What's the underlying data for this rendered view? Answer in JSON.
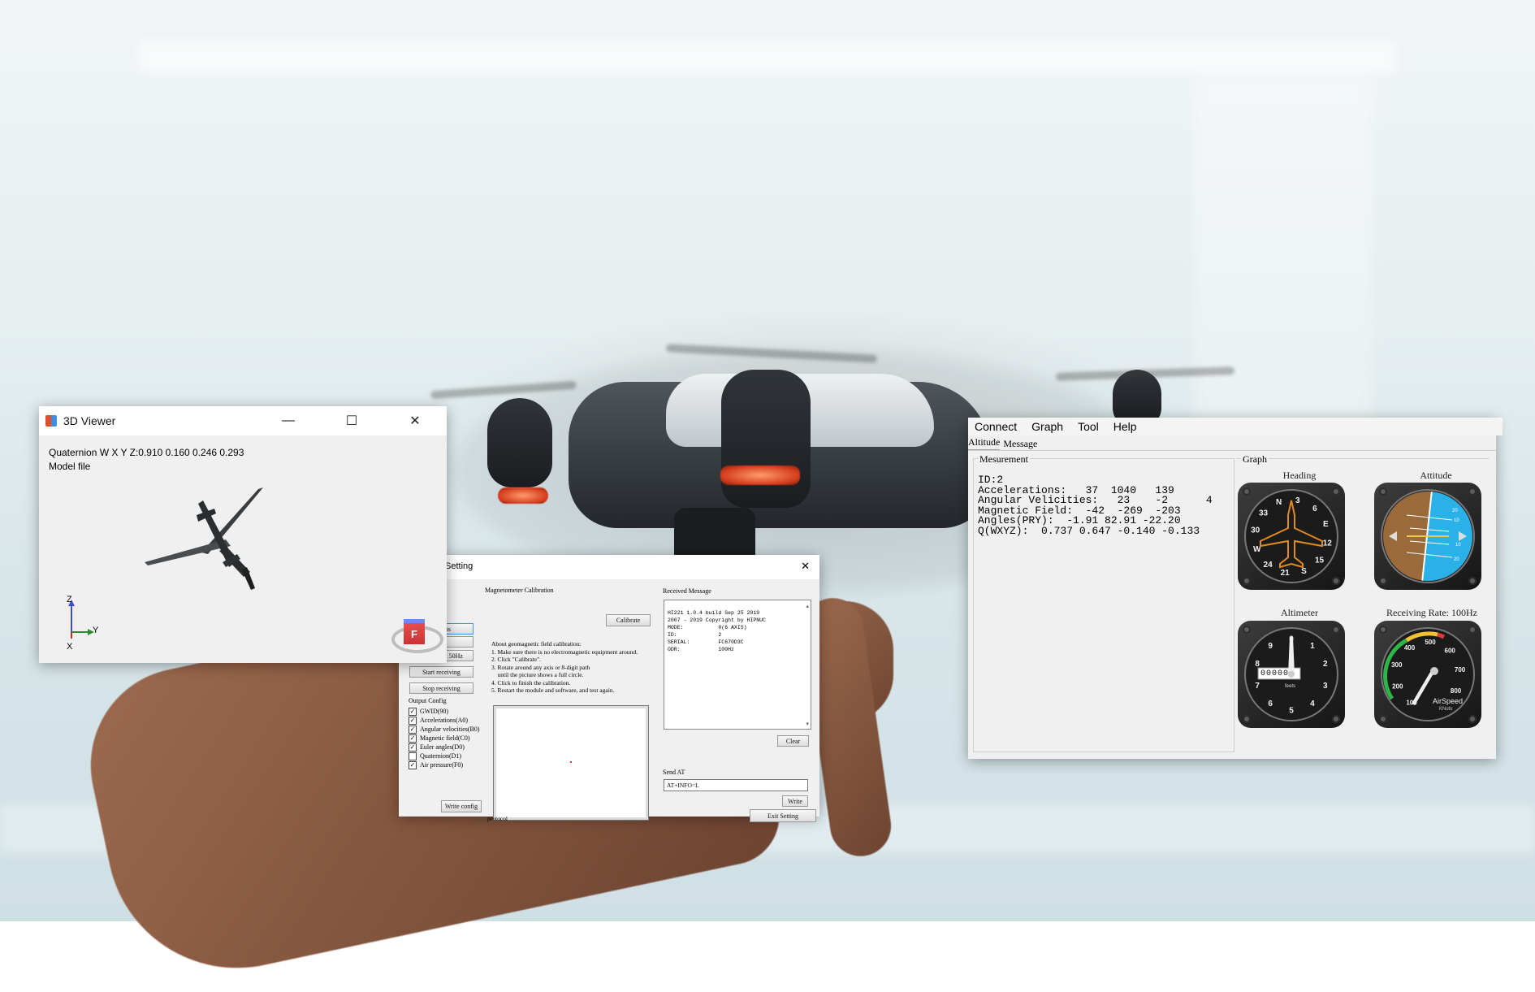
{
  "viewer": {
    "title": "3D Viewer",
    "quaternion_label": "Quaternion W X Y Z:0.910  0.160  0.246  0.293",
    "model_file_label": "Model file",
    "axis_z": "Z",
    "axis_y": "Y",
    "axis_x": "X",
    "cube_label": "F"
  },
  "settings": {
    "title_partial": "Setting",
    "left_buttons": [
      "nations",
      "Receive at 50Hz",
      "Start receiving",
      "Stop receiving"
    ],
    "output_config_label": "Output Config",
    "output_items": [
      {
        "label": "GWID(90)",
        "checked": true
      },
      {
        "label": "Accelerations(A0)",
        "checked": true
      },
      {
        "label": "Angular velocities(B0)",
        "checked": true
      },
      {
        "label": "Magnetic field(C0)",
        "checked": true
      },
      {
        "label": "Euler angles(D0)",
        "checked": true
      },
      {
        "label": "Quaternion(D1)",
        "checked": false
      },
      {
        "label": "Air pressure(F0)",
        "checked": true
      }
    ],
    "write_config_button": "Write config",
    "mag_cal_label": "Magnetometer Calibration",
    "calibrate_button": "Calibrate",
    "mag_instructions": [
      "About geomagnetic field calibration:",
      "1. Make sure there is no electromagnetic equipment around.",
      "2. Click \"Calibrate\".",
      "3. Rotate around any axis or 8-digit path",
      "    until the picture shows a full circle.",
      "4. Click to finish the calibration.",
      "5. Restart the module and software, and test again."
    ],
    "protocol_label": "protocol",
    "received_label": "Received Message",
    "received_lines": [
      "HI221 1.0.4 build Sep 25 2019",
      "2007 - 2019 Copyright by HIPNUC",
      "MODE:           0(6 AXIS)",
      "ID:             2",
      "SERIAL:         FC670D3C",
      "ODR:            100Hz"
    ],
    "clear_button": "Clear",
    "send_at_label": "Send AT",
    "send_at_value": "AT+INFO=L",
    "write_button": "Write",
    "exit_button": "Exit Setting"
  },
  "main_app": {
    "menu": [
      "Connect",
      "Graph",
      "Tool",
      "Help"
    ],
    "tabs": [
      "Altitude",
      "Message"
    ],
    "measurement_label": "Mesurement",
    "measurement_lines": [
      "ID:2",
      "Accelerations:   37  1040   139",
      "Angular Velicities:   23    -2      4",
      "Magnetic Field:  -42  -269  -203",
      "Angles(PRY):  -1.91 82.91 -22.20",
      "Q(WXYZ):  0.737 0.647 -0.140 -0.133"
    ],
    "graph_label": "Graph",
    "gauges": {
      "heading": {
        "title": "Heading",
        "labels": [
          "N",
          "3",
          "6",
          "E",
          "12",
          "15",
          "S",
          "21",
          "24",
          "W",
          "30",
          "33"
        ]
      },
      "attitude": {
        "title": "Attitude",
        "labels": [
          "10",
          "10",
          "20",
          "20"
        ]
      },
      "altimeter": {
        "title": "Altimeter",
        "labels": [
          "0",
          "1",
          "2",
          "3",
          "4",
          "5",
          "6",
          "7",
          "8",
          "9"
        ],
        "counter": "00000",
        "unit": "feets"
      },
      "airspeed": {
        "title": "Receiving Rate: 100Hz",
        "labels": [
          "100",
          "200",
          "300",
          "400",
          "500",
          "600",
          "700",
          "800"
        ],
        "caption": "AirSpeed",
        "unit": "KNots"
      }
    }
  }
}
